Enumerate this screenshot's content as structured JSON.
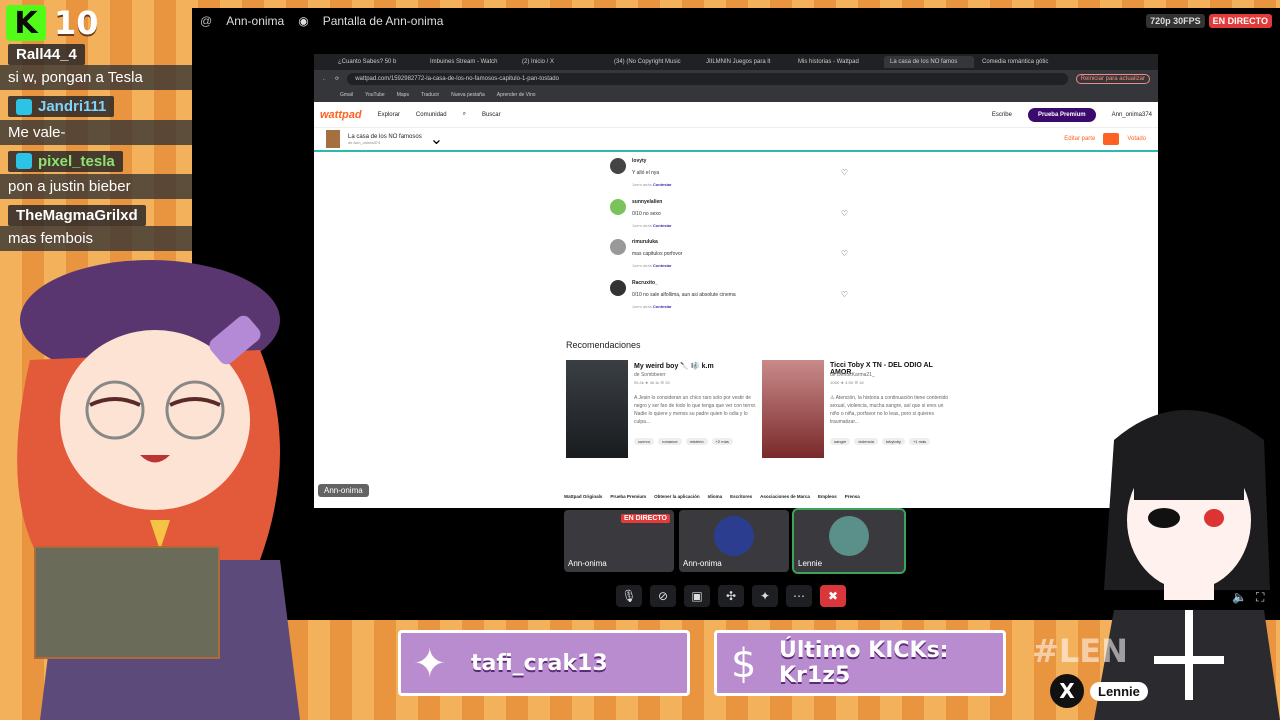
{
  "kick": {
    "count": "10"
  },
  "chat": [
    {
      "user": "Rall44_4",
      "text": "si w, pongan a Tesla"
    },
    {
      "user": "Jandri111",
      "text": "Me vale-"
    },
    {
      "user": "pixel_tesla",
      "text": "pon a justin bieber"
    },
    {
      "user": "TheMagmaGrilxd",
      "text": "mas fembois"
    }
  ],
  "discord": {
    "channel": "Ann-onima",
    "screen_title": "Pantalla de Ann-onima",
    "quality": "720p 30FPS",
    "live": "EN DIRECTO"
  },
  "browser": {
    "tabs": [
      "¿Cuanto Sabes? 50 b",
      "Imbuines Stream - Watch",
      "(2) Inicio / X",
      "(34) (No Copyright Music",
      "JIILMNIN Juegos para lt",
      "Mis historias - Wattpad",
      "La casa de los NO famos",
      "Comedia romántica gótic"
    ],
    "url": "wattpad.com/1592982772-la-casa-de-los-no-famosos-capitulo-1-pan-tostado",
    "update_label": "Reiniciar para actualizar",
    "bookmarks": [
      "Gmail",
      "YouTube",
      "Maps",
      "Traducir",
      "Nueva pestaña",
      "Aprender de Vino"
    ]
  },
  "wattpad": {
    "logo": "wattpad",
    "explore": "Explorar",
    "community": "Comunidad",
    "search": "Buscar",
    "write": "Escribe",
    "premium": "Prueba Premium",
    "user": "Ann_onima374",
    "story_title": "La casa de los NO famosos",
    "story_author": "de Ann_onima374",
    "edit": "Editar parte",
    "voted": "Votado",
    "reply_label": "Contestar",
    "comments": [
      {
        "user": "lovyty",
        "text": "Y alló el nya",
        "time": "1sem atrás"
      },
      {
        "user": "sunnyelalien",
        "text": "0/10 no sexo",
        "time": "1sem atrás"
      },
      {
        "user": "rimuruluka",
        "text": "mas capitulos porfovor",
        "time": "1sem atrás"
      },
      {
        "user": "Racruxito_",
        "text": "0/10 no sale alfollima, aun asi absolute cinema",
        "time": "1sem atrás"
      }
    ],
    "recs_title": "Recomendaciones",
    "recs": [
      {
        "title": "My weird boy 🔪 🎼 k.m",
        "author": "de Sombbeerr",
        "stats": "95,4k  ★ 46,1k  ☰ 33",
        "desc": "A Jesin lo consideran un chico raro solo por vestir de negro y ser fan de todo lo que tenga que ver con terror. Nadie lo quiere y menos su padre quien lo odia y lo culpa...",
        "tags": [
          "cuervo",
          "romance",
          "misterio",
          "+2 más"
        ]
      },
      {
        "title": "Ticci Toby X TN - DEL ODIO AL AMOR",
        "author": "de DetroitKarma21_",
        "stats": "106K  ★ 4,5K  ☰ 18",
        "desc": "⚠ Atención, la historia a continuación tiene contenido sexual, violencia, mucha sangre, así que si eres un niño o niña, porfavor no lo leas, pero si quieres traumatizar...",
        "tags": [
          "sangre",
          "violencia",
          "tobytoby",
          "+1 más"
        ]
      }
    ],
    "footer": [
      "Wattpad Originals",
      "Prueba Premium",
      "Obtener la aplicación",
      "Idioma",
      "Escritores",
      "Asociaciones de Marca",
      "Empleos",
      "Prensa"
    ]
  },
  "screen_owner": "Ann-onima",
  "tiles": [
    {
      "name": "Ann-onima",
      "live": "EN DIRECTO"
    },
    {
      "name": "Ann-onima"
    },
    {
      "name": "Lennie"
    }
  ],
  "banners": {
    "left": "tafi_crak13",
    "right": "Último KICKs: Kr1z5"
  },
  "hashtag": "#LEN",
  "handle": "Lennie"
}
